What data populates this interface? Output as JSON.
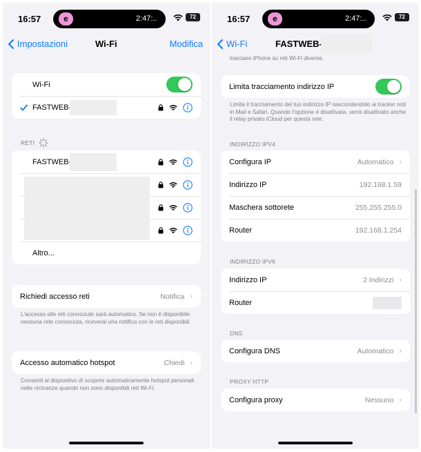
{
  "left": {
    "status": {
      "time": "16:57",
      "app_letter": "e",
      "pill_time": "2:47:..",
      "battery": "72"
    },
    "nav": {
      "back_label": "Impostazioni",
      "title": "Wi-Fi",
      "edit_label": "Modifica"
    },
    "wifi_card": {
      "toggle_label": "Wi-Fi",
      "toggle_on": true,
      "connected_network": "FASTWEB-"
    },
    "networks_header": "RETI",
    "networks": [
      {
        "name": "FASTWEB-"
      },
      {
        "name": ""
      },
      {
        "name": ""
      },
      {
        "name": ""
      }
    ],
    "other_label": "Altro...",
    "ask_join": {
      "label": "Richiedi accesso reti",
      "value": "Notifica"
    },
    "ask_join_note": "L'accesso alle reti conosciute sarà automatico. Se non è disponibile nessuna rete conosciuta, riceverai una notifica con le reti disponibili.",
    "hotspot": {
      "label": "Accesso automatico hotspot",
      "value": "Chiedi"
    },
    "hotspot_note": "Consenti al dispositivo di scoprire automaticamente hotspot personali nelle vicinanze quando non sono disponibili reti Wi-Fi."
  },
  "right": {
    "status": {
      "time": "16:57",
      "app_letter": "e",
      "pill_time": "2:47:..",
      "battery": "72"
    },
    "nav": {
      "back_label": "Wi-Fi",
      "title": "FASTWEB-"
    },
    "top_note": "tracciare iPhone su reti Wi-Fi diverse.",
    "limit_tracking": {
      "label": "Limita tracciamento indirizzo IP",
      "on": true
    },
    "limit_note": "Limita il tracciamento del tuo indirizzo IP nascondendolo ai tracker noti in Mail e Safari. Quando l'opzione è disattivata, verrà disattivato anche il relay privato iCloud per questa rete.",
    "ipv4_header": "INDIRIZZO IPV4",
    "ipv4": [
      {
        "label": "Configura IP",
        "value": "Automatico"
      },
      {
        "label": "Indirizzo IP",
        "value": "192.168.1.59"
      },
      {
        "label": "Maschera sottorete",
        "value": "255.255.255.0"
      },
      {
        "label": "Router",
        "value": "192.168.1.254"
      }
    ],
    "ipv6_header": "INDIRIZZO IPV6",
    "ipv6": [
      {
        "label": "Indirizzo IP",
        "value": "2 Indirizzi"
      },
      {
        "label": "Router",
        "value": ""
      }
    ],
    "dns_header": "DNS",
    "dns": {
      "label": "Configura DNS",
      "value": "Automatico"
    },
    "proxy_header": "PROXY HTTP",
    "proxy": {
      "label": "Configura proxy",
      "value": "Nessuno"
    }
  },
  "colors": {
    "accent": "#0a7cff",
    "toggle_on": "#34c759",
    "background": "#f2f2f7",
    "secondary_text": "#8a8a8e"
  }
}
